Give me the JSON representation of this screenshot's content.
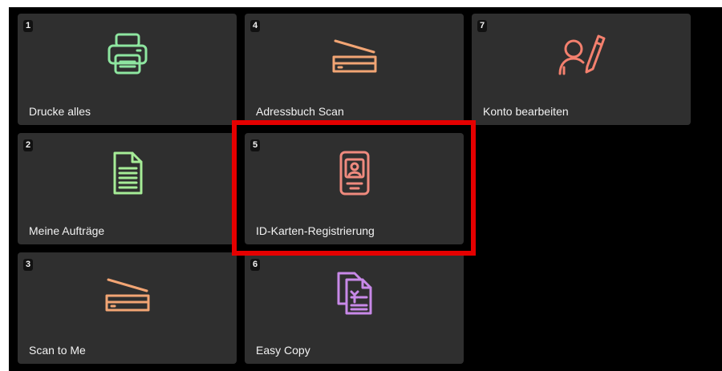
{
  "tiles": [
    {
      "number": "1",
      "label": "Drucke alles",
      "icon": "printer-icon"
    },
    {
      "number": "2",
      "label": "Meine Aufträge",
      "icon": "document-icon"
    },
    {
      "number": "3",
      "label": "Scan to Me",
      "icon": "scanner-icon"
    },
    {
      "number": "4",
      "label": "Adressbuch Scan",
      "icon": "scanner-icon"
    },
    {
      "number": "5",
      "label": "ID-Karten-Registrierung",
      "icon": "id-card-icon"
    },
    {
      "number": "6",
      "label": "Easy Copy",
      "icon": "easy-copy-icon"
    },
    {
      "number": "7",
      "label": "Konto bearbeiten",
      "icon": "edit-account-icon"
    }
  ],
  "colors": {
    "background": "#000000",
    "tile": "#2f2f2f",
    "printer_icon": "#8ee6a0",
    "document_icon": "#a6ec97",
    "scanner_icon": "#f2a574",
    "id_card_icon": "#ef8a7e",
    "easy_copy_icon": "#c889e8",
    "edit_account_icon": "#f4806e",
    "highlight": "#e50000"
  }
}
